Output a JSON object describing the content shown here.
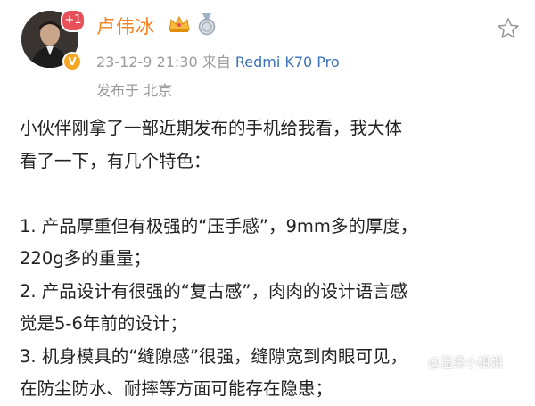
{
  "author": {
    "name": "卢伟冰",
    "follow_badge": "+1",
    "verified_mark": "V",
    "icons": [
      "crown-icon",
      "medal-icon"
    ]
  },
  "meta": {
    "timestamp": "23-12-9 21:30",
    "source_prefix": "来自",
    "device": "Redmi K70 Pro",
    "location": "发布于 北京"
  },
  "post": {
    "lines": [
      "小伙伴刚拿了一部近期发布的手机给我看，我大体",
      "看了一下，有几个特色：",
      "",
      "1. 产品厚重但有极强的“压手感”，9mm多的厚度，",
      "220g多的重量；",
      "2. 产品设计有很强的“复古感”，肉肉的设计语言感",
      "觉是5-6年前的设计；",
      "3. 机身模具的“缝隙感”很强，缝隙宽到肉眼可见，",
      "在防尘防水、耐摔等方面可能存在隐患；"
    ]
  },
  "watermark": "@温柔小姐姐",
  "colors": {
    "username": "#f28322",
    "device_link": "#3b6fb6",
    "meta_gray": "#9a9a9a",
    "follow_badge": "#e8505a"
  }
}
